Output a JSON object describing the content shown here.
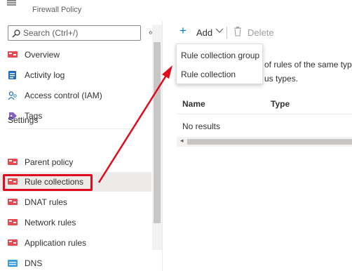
{
  "header": {
    "title": "Firewall Policy",
    "subtitle": "Firewall Policy",
    "icon": "firewall-policy-icon"
  },
  "sidebar": {
    "search_placeholder": "Search (Ctrl+/)",
    "collapse_glyph": "«",
    "section_settings": "Settings",
    "items": [
      {
        "label": "Overview",
        "icon": "overview-icon"
      },
      {
        "label": "Activity log",
        "icon": "activity-log-icon"
      },
      {
        "label": "Access control (IAM)",
        "icon": "iam-icon"
      },
      {
        "label": "Tags",
        "icon": "tag-icon"
      },
      {
        "label": "Parent policy",
        "icon": "parent-policy-icon"
      },
      {
        "label": "Rule collections",
        "icon": "rule-collections-icon"
      },
      {
        "label": "DNAT rules",
        "icon": "dnat-rules-icon"
      },
      {
        "label": "Network rules",
        "icon": "network-rules-icon"
      },
      {
        "label": "Application rules",
        "icon": "application-rules-icon"
      },
      {
        "label": "DNS",
        "icon": "dns-icon"
      }
    ]
  },
  "toolbar": {
    "add_label": "Add",
    "delete_label": "Delete"
  },
  "dropdown": {
    "options": [
      "Rule collection group",
      "Rule collection"
    ]
  },
  "description": {
    "line1": "of rules of the same type",
    "line2": "us types."
  },
  "grid": {
    "columns": [
      "Name",
      "Type"
    ],
    "empty_text": "No results"
  },
  "colors": {
    "accent": "#0078d4",
    "highlight_red": "#e00b1c"
  }
}
